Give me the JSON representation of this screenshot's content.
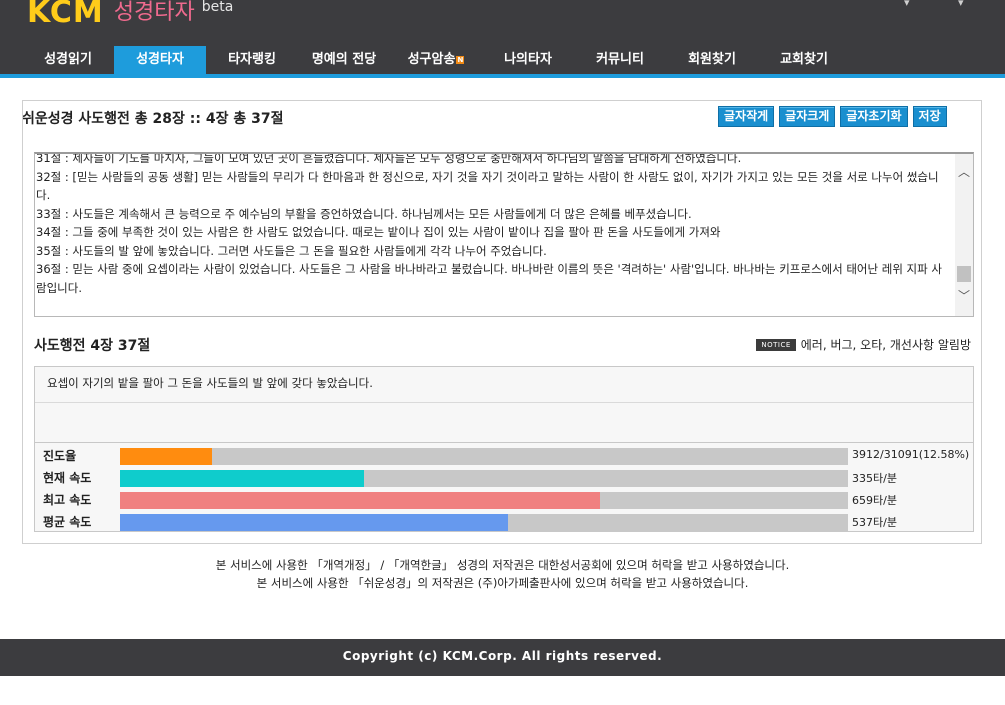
{
  "header": {
    "logo_text": "KCM",
    "logo_sub": "성경타자",
    "logo_beta": "beta"
  },
  "nav": {
    "items": [
      {
        "label": "성경읽기",
        "active": false
      },
      {
        "label": "성경타자",
        "active": true
      },
      {
        "label": "타자랭킹",
        "active": false
      },
      {
        "label": "명예의 전당",
        "active": false
      },
      {
        "label": "성구암송",
        "active": false,
        "badge": "N"
      },
      {
        "label": "나의타자",
        "active": false
      },
      {
        "label": "커뮤니티",
        "active": false
      },
      {
        "label": "회원찾기",
        "active": false
      },
      {
        "label": "교회찾기",
        "active": false
      }
    ]
  },
  "main": {
    "title": "쉬운성경 사도행전 총 28장 :: 4장 총 37절",
    "buttons": [
      "글자작게",
      "글자크게",
      "글자초기화",
      "저장"
    ],
    "verses": [
      "31절 : 제자들이 기도를 마치자, 그들이 모여 있던 곳이 흔들렸습니다. 제자들은 모두 성령으로 충만해져서 하나님의 말씀을 담대하게 전하였습니다.",
      "32절 : [믿는 사람들의 공동 생활] 믿는 사람들의 무리가 다 한마음과 한 정신으로, 자기 것을 자기 것이라고 말하는 사람이 한 사람도 없이, 자기가 가지고 있는 모든 것을 서로 나누어 썼습니다.",
      "33절 : 사도들은 계속해서 큰 능력으로 주 예수님의 부활을 증언하였습니다. 하나님께서는 모든 사람들에게 더 많은 은혜를 베푸셨습니다.",
      "34절 : 그들 중에 부족한 것이 있는 사람은 한 사람도 없었습니다. 때로는 밭이나 집이 있는 사람이 밭이나 집을 팔아 판 돈을 사도들에게 가져와",
      "35절 : 사도들의 발 앞에 놓았습니다. 그러면 사도들은 그 돈을 필요한 사람들에게 각각 나누어 주었습니다.",
      "36절 : 믿는 사람 중에 요셉이라는 사람이 있었습니다. 사도들은 그 사람을 바나바라고 불렀습니다. 바나바란 이름의 뜻은 '격려하는' 사람'입니다. 바나바는 키프로스에서 태어난 레위 지파 사람입니다."
    ],
    "verse_ref": "사도행전 4장 37절",
    "notice_badge": "NOTICE",
    "notice_text": "에러, 버그, 오타, 개선사항 알림방",
    "target_text": "요셉이 자기의 밭을 팔아 그 돈을 사도들의 발 앞에 갖다 놓았습니다.",
    "stats": [
      {
        "label": "진도율",
        "value": "3912/31091(12.58%)",
        "fraction": 0.1258,
        "color": "#ff8c0f"
      },
      {
        "label": "현재 속도",
        "value": "335타/분",
        "fraction": 0.335,
        "color": "#0fcccc"
      },
      {
        "label": "최고 속도",
        "value": "659타/분",
        "fraction": 0.659,
        "color": "#f08080"
      },
      {
        "label": "평균 속도",
        "value": "537타/분",
        "fraction": 0.533,
        "color": "#6699ee"
      }
    ]
  },
  "footer": {
    "credit_line1": "본 서비스에 사용한 「개역개정」 / 「개역한글」 성경의 저작권은 대한성서공회에 있으며 허락을 받고 사용하였습니다.",
    "credit_line2": "본 서비스에 사용한 「쉬운성경」의 저작권은 (주)아가페출판사에 있으며 허락을 받고 사용하였습니다.",
    "copyright": "Copyright (c) KCM.Corp. All rights reserved."
  }
}
